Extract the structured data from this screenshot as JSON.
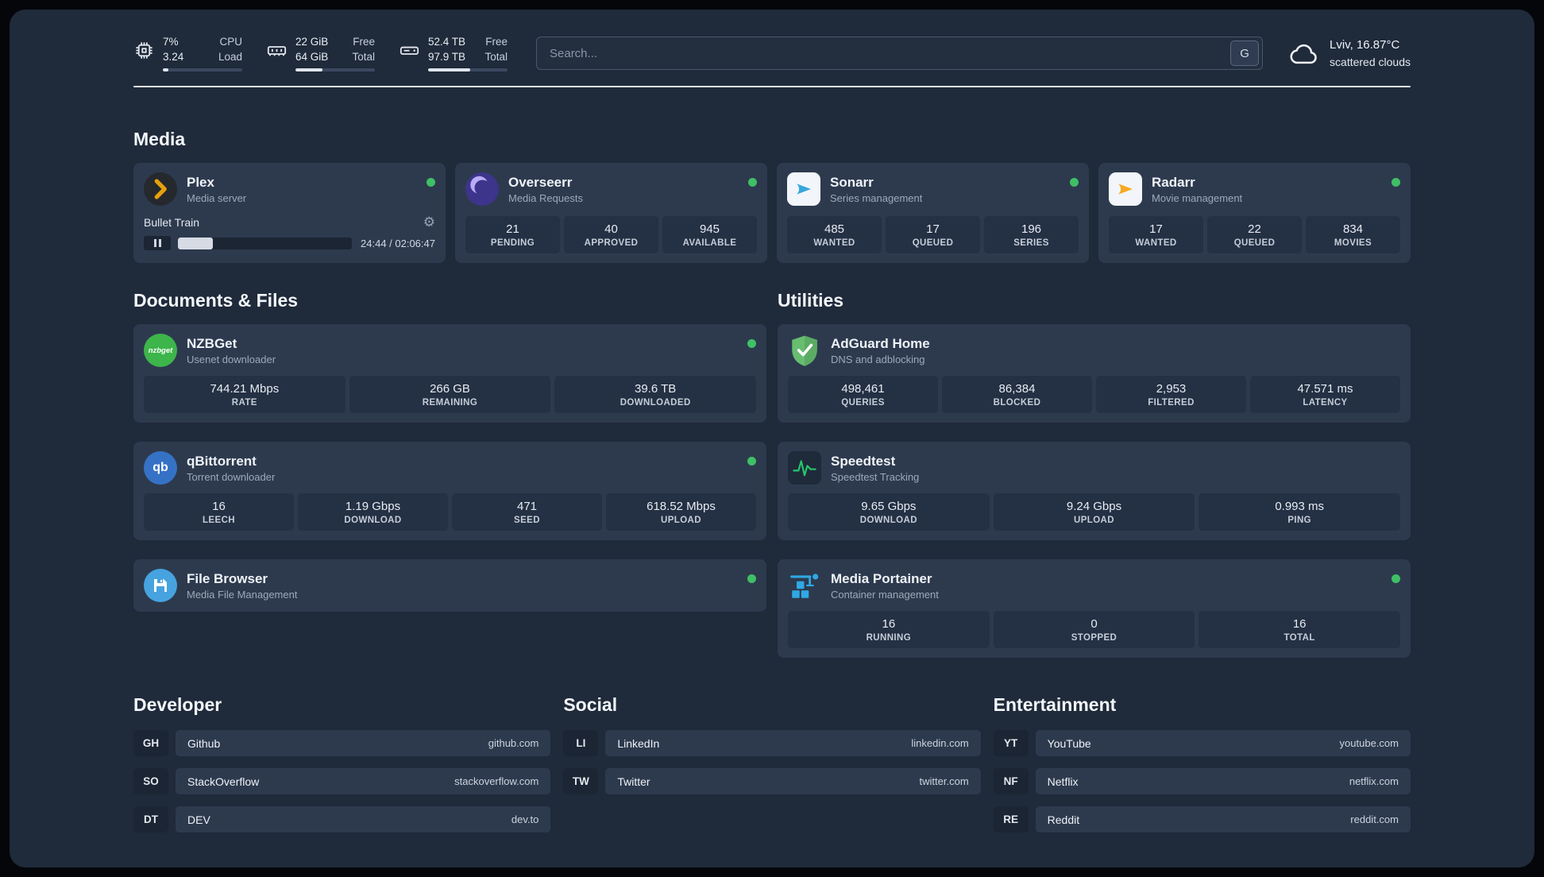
{
  "topbar": {
    "cpu": {
      "value": "7%",
      "sub": "3.24",
      "label1": "CPU",
      "label2": "Load",
      "percent": 7
    },
    "ram": {
      "value": "22 GiB",
      "sub": "64 GiB",
      "label1": "Free",
      "label2": "Total",
      "percent": 34
    },
    "disk": {
      "value": "52.4 TB",
      "sub": "97.9 TB",
      "label1": "Free",
      "label2": "Total",
      "percent": 53
    },
    "search": {
      "placeholder": "Search...",
      "key_hint": "G"
    },
    "weather": {
      "location": "Lviv, 16.87°C",
      "condition": "scattered clouds"
    }
  },
  "media": {
    "heading": "Media",
    "plex": {
      "title": "Plex",
      "subtitle": "Media server",
      "now_playing": "Bullet Train",
      "time": "24:44 / 02:06:47",
      "progress_percent": 20
    },
    "overseerr": {
      "title": "Overseerr",
      "subtitle": "Media Requests",
      "stats": [
        {
          "value": "21",
          "label": "PENDING"
        },
        {
          "value": "40",
          "label": "APPROVED"
        },
        {
          "value": "945",
          "label": "AVAILABLE"
        }
      ]
    },
    "sonarr": {
      "title": "Sonarr",
      "subtitle": "Series management",
      "stats": [
        {
          "value": "485",
          "label": "WANTED"
        },
        {
          "value": "17",
          "label": "QUEUED"
        },
        {
          "value": "196",
          "label": "SERIES"
        }
      ]
    },
    "radarr": {
      "title": "Radarr",
      "subtitle": "Movie management",
      "stats": [
        {
          "value": "17",
          "label": "WANTED"
        },
        {
          "value": "22",
          "label": "QUEUED"
        },
        {
          "value": "834",
          "label": "MOVIES"
        }
      ]
    }
  },
  "documents": {
    "heading": "Documents & Files",
    "nzbget": {
      "title": "NZBGet",
      "subtitle": "Usenet downloader",
      "icon_text": "nzbget",
      "stats": [
        {
          "value": "744.21 Mbps",
          "label": "RATE"
        },
        {
          "value": "266 GB",
          "label": "REMAINING"
        },
        {
          "value": "39.6 TB",
          "label": "DOWNLOADED"
        }
      ]
    },
    "qbittorrent": {
      "title": "qBittorrent",
      "subtitle": "Torrent downloader",
      "icon_text": "qb",
      "stats": [
        {
          "value": "16",
          "label": "LEECH"
        },
        {
          "value": "1.19 Gbps",
          "label": "DOWNLOAD"
        },
        {
          "value": "471",
          "label": "SEED"
        },
        {
          "value": "618.52 Mbps",
          "label": "UPLOAD"
        }
      ]
    },
    "filebrowser": {
      "title": "File Browser",
      "subtitle": "Media File Management"
    }
  },
  "utilities": {
    "heading": "Utilities",
    "adguard": {
      "title": "AdGuard Home",
      "subtitle": "DNS and adblocking",
      "stats": [
        {
          "value": "498,461",
          "label": "QUERIES"
        },
        {
          "value": "86,384",
          "label": "BLOCKED"
        },
        {
          "value": "2,953",
          "label": "FILTERED"
        },
        {
          "value": "47.571 ms",
          "label": "LATENCY"
        }
      ]
    },
    "speedtest": {
      "title": "Speedtest",
      "subtitle": "Speedtest Tracking",
      "stats": [
        {
          "value": "9.65 Gbps",
          "label": "DOWNLOAD"
        },
        {
          "value": "9.24 Gbps",
          "label": "UPLOAD"
        },
        {
          "value": "0.993 ms",
          "label": "PING"
        }
      ]
    },
    "portainer": {
      "title": "Media Portainer",
      "subtitle": "Container management",
      "stats": [
        {
          "value": "16",
          "label": "RUNNING"
        },
        {
          "value": "0",
          "label": "STOPPED"
        },
        {
          "value": "16",
          "label": "TOTAL"
        }
      ]
    }
  },
  "bookmarks": {
    "developer": {
      "heading": "Developer",
      "items": [
        {
          "abbr": "GH",
          "name": "Github",
          "url": "github.com"
        },
        {
          "abbr": "SO",
          "name": "StackOverflow",
          "url": "stackoverflow.com"
        },
        {
          "abbr": "DT",
          "name": "DEV",
          "url": "dev.to"
        }
      ]
    },
    "social": {
      "heading": "Social",
      "items": [
        {
          "abbr": "LI",
          "name": "LinkedIn",
          "url": "linkedin.com"
        },
        {
          "abbr": "TW",
          "name": "Twitter",
          "url": "twitter.com"
        }
      ]
    },
    "entertainment": {
      "heading": "Entertainment",
      "items": [
        {
          "abbr": "YT",
          "name": "YouTube",
          "url": "youtube.com"
        },
        {
          "abbr": "NF",
          "name": "Netflix",
          "url": "netflix.com"
        },
        {
          "abbr": "RE",
          "name": "Reddit",
          "url": "reddit.com"
        }
      ]
    }
  },
  "icons": {
    "topbar": [
      "cpu-icon",
      "ram-icon",
      "disk-icon",
      "cloud-icon"
    ],
    "apps": [
      "plex-icon",
      "overseerr-icon",
      "sonarr-icon",
      "radarr-icon",
      "nzbget-icon",
      "qbittorrent-icon",
      "filebrowser-icon",
      "adguard-icon",
      "speedtest-icon",
      "portainer-icon"
    ],
    "misc": [
      "gear-icon",
      "pause-icon",
      "status-dot"
    ]
  },
  "colors": {
    "page_bg": "#1f2a3a",
    "card_bg": "#2d3a4e",
    "stat_bg": "#243043",
    "status_green": "#3fc065",
    "plex_amber": "#e5a00d",
    "sonarr_blue": "#36a6dd",
    "radarr_amber": "#f7a823",
    "adguard_green": "#68bd71",
    "portainer_blue": "#2ea9e5"
  }
}
